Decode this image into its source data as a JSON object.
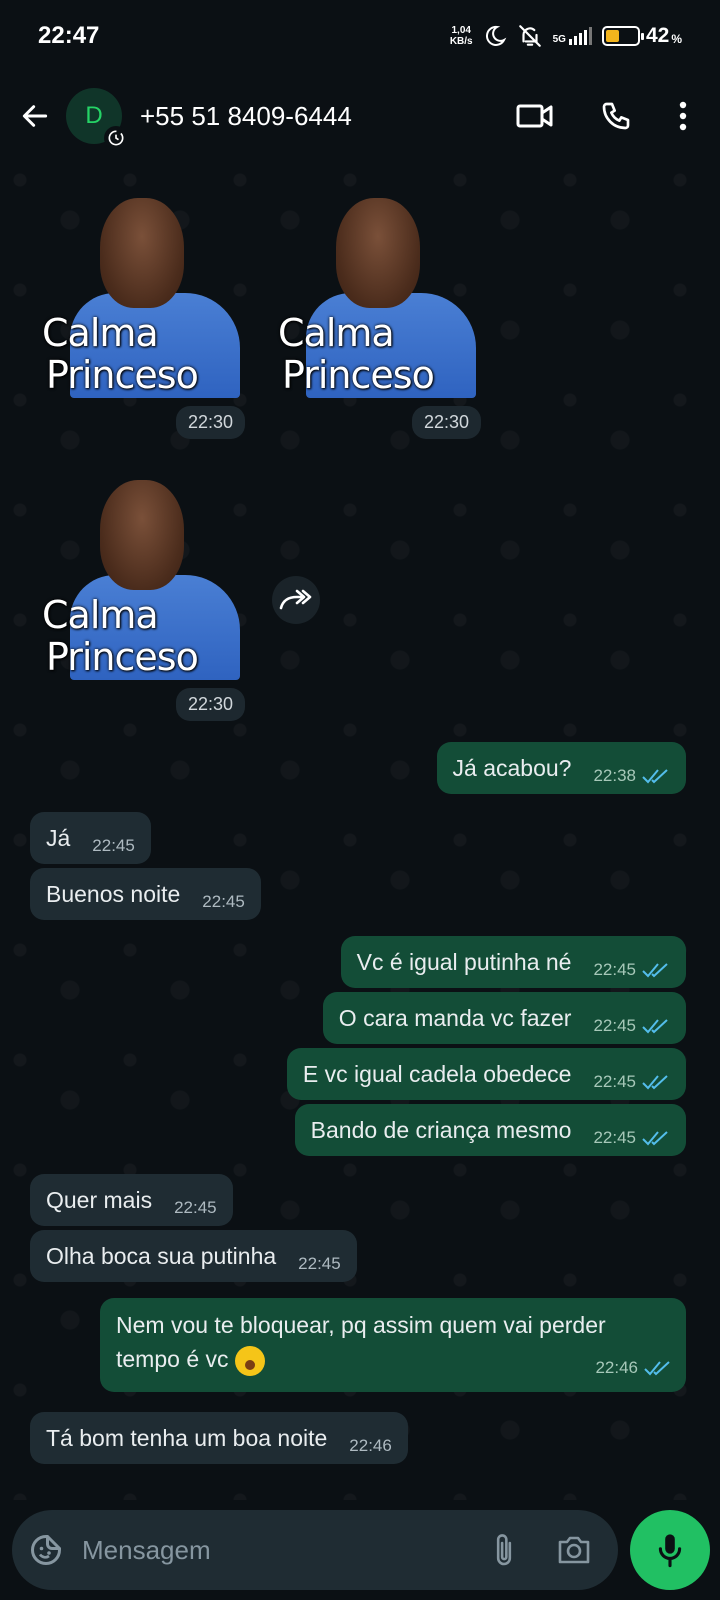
{
  "status_bar": {
    "time": "22:47",
    "net_speed_value": "1,04",
    "net_speed_unit": "KB/s",
    "network": "5G",
    "battery_percent": "42",
    "battery_level": 0.42,
    "icons": [
      "moon-icon",
      "bell-off-icon",
      "signal-icon",
      "battery-icon"
    ]
  },
  "header": {
    "avatar_letter": "D",
    "contact": "+55 51 8409-6444",
    "icons": [
      "back-arrow-icon",
      "disappearing-timer-icon",
      "video-call-icon",
      "phone-icon",
      "more-vert-icon"
    ]
  },
  "stickers": [
    {
      "line1": "Calma",
      "line2": "Princeso",
      "time": "22:30"
    },
    {
      "line1": "Calma",
      "line2": "Princeso",
      "time": "22:30"
    },
    {
      "line1": "Calma",
      "line2": "Princeso",
      "time": "22:30"
    }
  ],
  "messages": [
    {
      "dir": "out",
      "text": "Já acabou?",
      "time": "22:38"
    },
    {
      "dir": "in",
      "text": "Já",
      "time": "22:45"
    },
    {
      "dir": "in",
      "text": "Buenos noite",
      "time": "22:45"
    },
    {
      "dir": "out",
      "text": "Vc é igual putinha né",
      "time": "22:45"
    },
    {
      "dir": "out",
      "text": "O cara manda vc fazer",
      "time": "22:45"
    },
    {
      "dir": "out",
      "text": "E vc igual cadela obedece",
      "time": "22:45"
    },
    {
      "dir": "out",
      "text": "Bando de criança mesmo",
      "time": "22:45"
    },
    {
      "dir": "in",
      "text": "Quer mais",
      "time": "22:45"
    },
    {
      "dir": "in",
      "text": "Olha boca sua putinha",
      "time": "22:45"
    },
    {
      "dir": "out",
      "text_line1": "Nem vou te bloquear, pq assim quem vai perder",
      "text_line2": "tempo é vc",
      "time": "22:46"
    },
    {
      "dir": "in",
      "text": "Tá bom tenha um boa noite",
      "time": "22:46"
    }
  ],
  "input": {
    "placeholder": "Mensagem",
    "icons": [
      "emoji-sticker-icon",
      "attach-clip-icon",
      "camera-icon",
      "mic-icon"
    ]
  },
  "colors": {
    "background": "#0b1014",
    "incoming_bubble": "#1f2c33",
    "outgoing_bubble": "#134d37",
    "read_ticks": "#53bdeb",
    "mic_button": "#21c063"
  }
}
